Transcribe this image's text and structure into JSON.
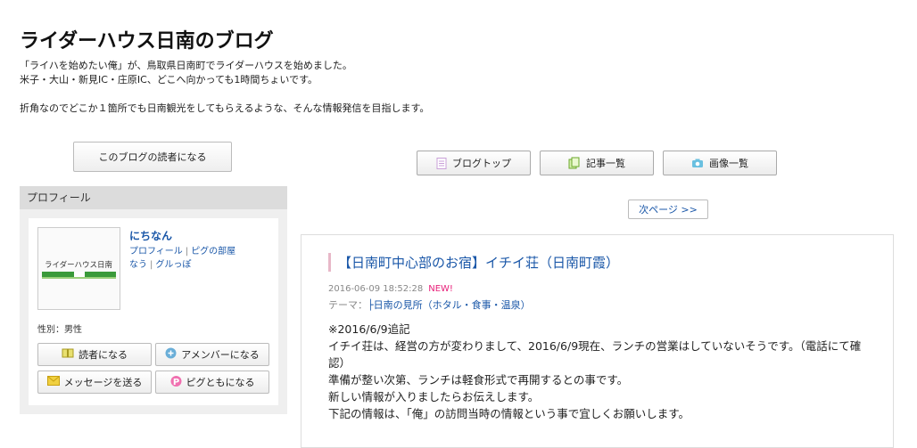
{
  "blog": {
    "title": "ライダーハウス日南のブログ",
    "description": [
      "「ライハを始めたい俺」が、鳥取県日南町でライダーハウスを始めました。",
      "米子・大山・新見IC・庄原IC、どこへ向かっても1時間ちょいです。",
      "折角なのでどこか１箇所でも日南観光をしてもらえるような、そんな情報発信を目指します。"
    ]
  },
  "buttons": {
    "reader": "このブログの読者になる",
    "blog_top": "ブログトップ",
    "article_list": "記事一覧",
    "image_list": "画像一覧",
    "next_page": "次ページ >>"
  },
  "profile": {
    "heading": "プロフィール",
    "avatar_text": "ライダーハウス日南",
    "name": "にちなん",
    "links": [
      "プロフィール",
      "ピグの部屋",
      "なう",
      "グルっぽ"
    ],
    "sex_label": "性別：",
    "sex_value": "男性",
    "actions": {
      "reader": "読者になる",
      "amember": "アメンバーになる",
      "message": "メッセージを送る",
      "pigg_friend": "ピグともになる"
    }
  },
  "article": {
    "title": "【日南町中心部のお宿】イチイ荘（日南町霞）",
    "date": "2016-06-09 18:52:28",
    "new_badge": "NEW!",
    "theme_label": "テーマ：",
    "theme_value": "├日南の見所（ホタル・食事・温泉）",
    "body": [
      "※2016/6/9追記",
      "イチイ荘は、経営の方が変わりまして、2016/6/9現在、ランチの営業はしていないそうです。（電話にて確認）",
      "準備が整い次第、ランチは軽食形式で再開するとの事です。",
      "新しい情報が入りましたらお伝えします。",
      "下記の情報は、「俺」の訪問当時の情報という事で宜しくお願いします。"
    ]
  },
  "colors": {
    "link": "#1a57a8",
    "new_badge": "#e8207a",
    "profile_bg": "#efefef"
  },
  "icons": {
    "blog_top": "document-icon",
    "article_list": "copy-icon",
    "image_list": "camera-icon",
    "reader": "book-icon",
    "amember": "chat-icon",
    "message": "envelope-icon",
    "pigg_friend": "pigg-p-icon"
  }
}
